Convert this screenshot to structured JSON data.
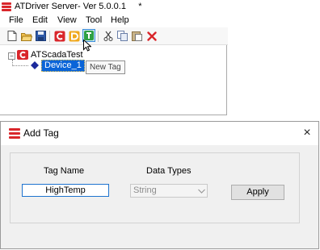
{
  "main_window": {
    "title": "ATDriver Server- Ver 5.0.0.1     *",
    "menu": [
      "File",
      "Edit",
      "View",
      "Tool",
      "Help"
    ],
    "toolbar_icons": [
      "new-file-icon",
      "open-folder-icon",
      "save-icon",
      "add-channel-icon",
      "add-device-icon",
      "add-tag-icon",
      "cut-icon",
      "copy-icon",
      "paste-icon",
      "delete-icon"
    ],
    "tree": {
      "root": "ATScadaTest",
      "device": "Device_1"
    },
    "tooltip": "New Tag"
  },
  "dialog": {
    "title": "Add Tag",
    "close": "×",
    "tag_name_label": "Tag Name",
    "tag_name_value": "HighTemp",
    "data_types_label": "Data Types",
    "data_type_value": "String",
    "apply_label": "Apply"
  },
  "colors": {
    "brand_red": "#d9262b",
    "selection_blue": "#0a64d8",
    "focus_border": "#1e73cf"
  }
}
